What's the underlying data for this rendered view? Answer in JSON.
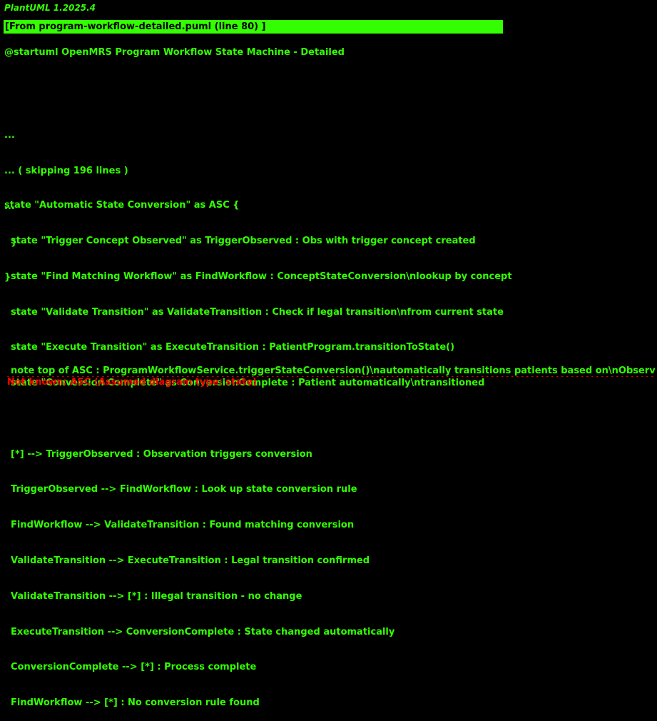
{
  "app": {
    "version": "PlantUML 1.2025.4"
  },
  "source": {
    "label": "[From program-workflow-detailed.puml (line 80) ]"
  },
  "header": {
    "startuml": "@startuml OpenMRS Program Workflow State Machine - Detailed"
  },
  "skipped": [
    "...",
    "... ( skipping 196 lines )",
    "...",
    "  }",
    "}"
  ],
  "code_lines": [
    "state \"Automatic State Conversion\" as ASC {",
    "  state \"Trigger Concept Observed\" as TriggerObserved : Obs with trigger concept created",
    "  state \"Find Matching Workflow\" as FindWorkflow : ConceptStateConversion\\nlookup by concept",
    "  state \"Validate Transition\" as ValidateTransition : Check if legal transition\\nfrom current state",
    "  state \"Execute Transition\" as ExecuteTransition : PatientProgram.transitionToState()",
    "  state \"Conversion Complete\" as ConversionComplete : Patient automatically\\ntransitioned",
    "",
    "  [*] --> TriggerObserved : Observation triggers conversion",
    "  TriggerObserved --> FindWorkflow : Look up state conversion rule",
    "  FindWorkflow --> ValidateTransition : Found matching conversion",
    "  ValidateTransition --> ExecuteTransition : Legal transition confirmed",
    "  ValidateTransition --> [*] : Illegal transition - no change",
    "  ExecuteTransition --> ConversionComplete : State changed automatically",
    "  ConversionComplete --> [*] : Process complete",
    "  FindWorkflow --> [*] : No conversion rule found"
  ],
  "note": "  note top of ASC : ProgramWorkflowService.triggerStateConversion()\\nautomatically transitions patients based on\\nObserv ...",
  "error": "Not known: ASC (Assumed diagram type: state)",
  "colors": {
    "background": "#000000",
    "text": "#33ff02",
    "error": "#ff0000"
  }
}
